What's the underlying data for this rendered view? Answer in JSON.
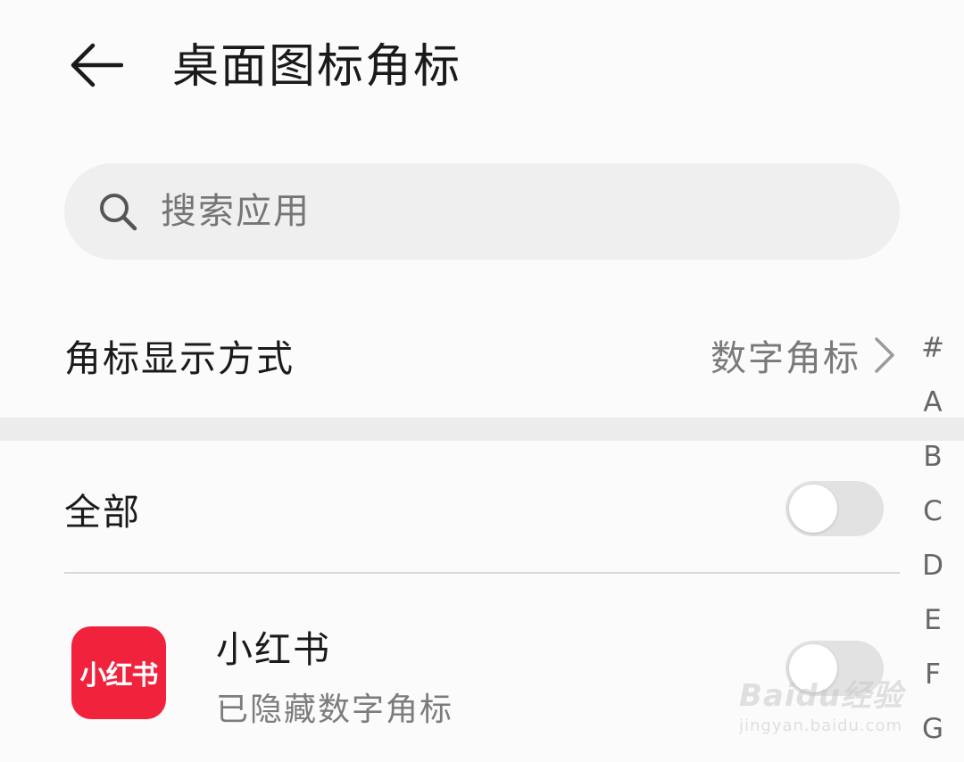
{
  "header": {
    "title": "桌面图标角标",
    "back_icon": "arrow-left-icon"
  },
  "search": {
    "placeholder": "搜索应用",
    "icon": "search-icon"
  },
  "badge_mode": {
    "label": "角标显示方式",
    "value": "数字角标",
    "icon": "chevron-right-icon"
  },
  "all_toggle": {
    "label": "全部",
    "on": false
  },
  "apps": [
    {
      "icon_text": "小红书",
      "name": "小红书",
      "status": "已隐藏数字角标",
      "toggle_on": false,
      "icon_color": "#f1233c"
    }
  ],
  "index_letters": [
    "#",
    "A",
    "B",
    "C",
    "D",
    "E",
    "F",
    "G"
  ],
  "watermark": {
    "main": "Baidu经验",
    "sub": "jingyan.baidu.com"
  },
  "colors": {
    "background": "#fbfbfb",
    "search_bg": "#efefef",
    "toggle_off": "#e2e2e2",
    "app_icon": "#f1233c"
  }
}
